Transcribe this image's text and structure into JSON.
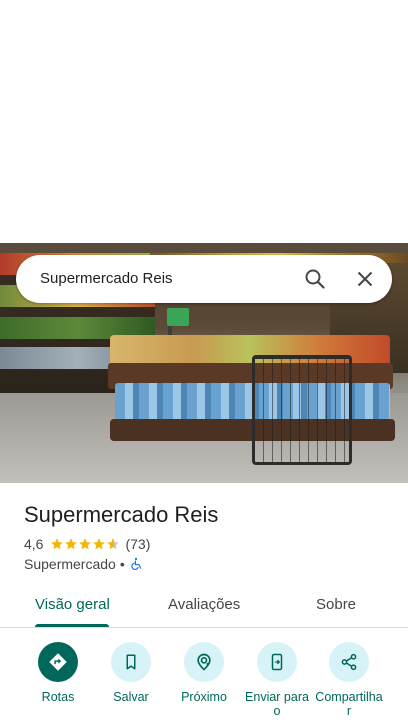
{
  "search": {
    "query": "Supermercado Reis"
  },
  "place": {
    "title": "Supermercado Reis",
    "rating": "4,6",
    "stars": 4.6,
    "reviews": "(73)",
    "category": "Supermercado",
    "separator": "•"
  },
  "tabs": [
    {
      "label": "Visão geral",
      "active": true
    },
    {
      "label": "Avaliações",
      "active": false
    },
    {
      "label": "Sobre",
      "active": false
    }
  ],
  "actions": [
    {
      "label": "Rotas",
      "icon": "directions-icon"
    },
    {
      "label": "Salvar",
      "icon": "bookmark-icon"
    },
    {
      "label": "Próximo",
      "icon": "nearby-icon"
    },
    {
      "label": "Enviar para o",
      "icon": "send-to-phone-icon"
    },
    {
      "label": "Compartilha r",
      "icon": "share-icon"
    }
  ],
  "colors": {
    "accent": "#00685a",
    "button_bg": "#d7f3f8",
    "star": "#f4b400"
  }
}
